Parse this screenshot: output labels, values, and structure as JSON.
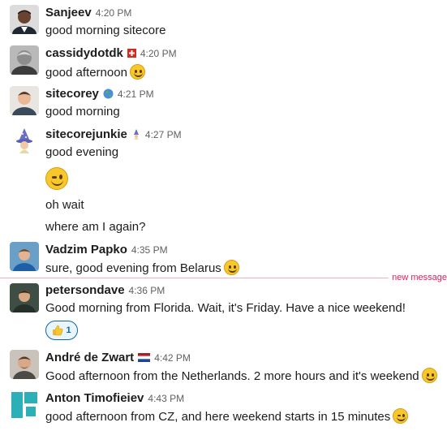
{
  "messages": [
    {
      "name": "Sanjeev",
      "time": "4:20 PM",
      "lines": [
        "good morning sitecore"
      ]
    },
    {
      "name": "cassidydotdk",
      "time": "4:20 PM",
      "flag_icon": "swiss-flag-icon",
      "lines": [
        "good afternoon"
      ],
      "emoji": "slightly-smiling-face-icon"
    },
    {
      "name": "sitecorey",
      "time": "4:21 PM",
      "flag_icon": "globe-icon",
      "lines": [
        "good morning"
      ]
    },
    {
      "name": "sitecorejunkie",
      "time": "4:27 PM",
      "flag_icon": "wizard-icon",
      "lines": [
        "good evening",
        "oh wait",
        "where am I again?"
      ],
      "big_emoji": "wink-face-icon"
    },
    {
      "name": "Vadzim Papko",
      "time": "4:35 PM",
      "lines": [
        "sure, good evening from Belarus"
      ],
      "emoji": "slightly-smiling-face-icon"
    },
    {
      "name": "petersondave",
      "time": "4:36 PM",
      "lines": [
        "Good morning from Florida. Wait, it's Friday. Have a nice weekend!"
      ],
      "reaction": {
        "icon": "thumbs-up-icon",
        "count": "1"
      }
    },
    {
      "name": "André de Zwart",
      "time": "4:42 PM",
      "flag_icon": "netherlands-flag-icon",
      "lines": [
        "Good afternoon from the Netherlands. 2 more hours and it's weekend"
      ],
      "emoji": "slightly-smiling-face-icon"
    },
    {
      "name": "Anton Timofieiev",
      "time": "4:43 PM",
      "lines": [
        "good afternoon from CZ, and here weekend starts in 15 minutes"
      ],
      "emoji": "wink-face-icon"
    }
  ],
  "divider": {
    "label": "new message"
  },
  "colors": {
    "divider": "#e01e5a",
    "reaction_border": "#1264a3",
    "time": "#616061"
  }
}
